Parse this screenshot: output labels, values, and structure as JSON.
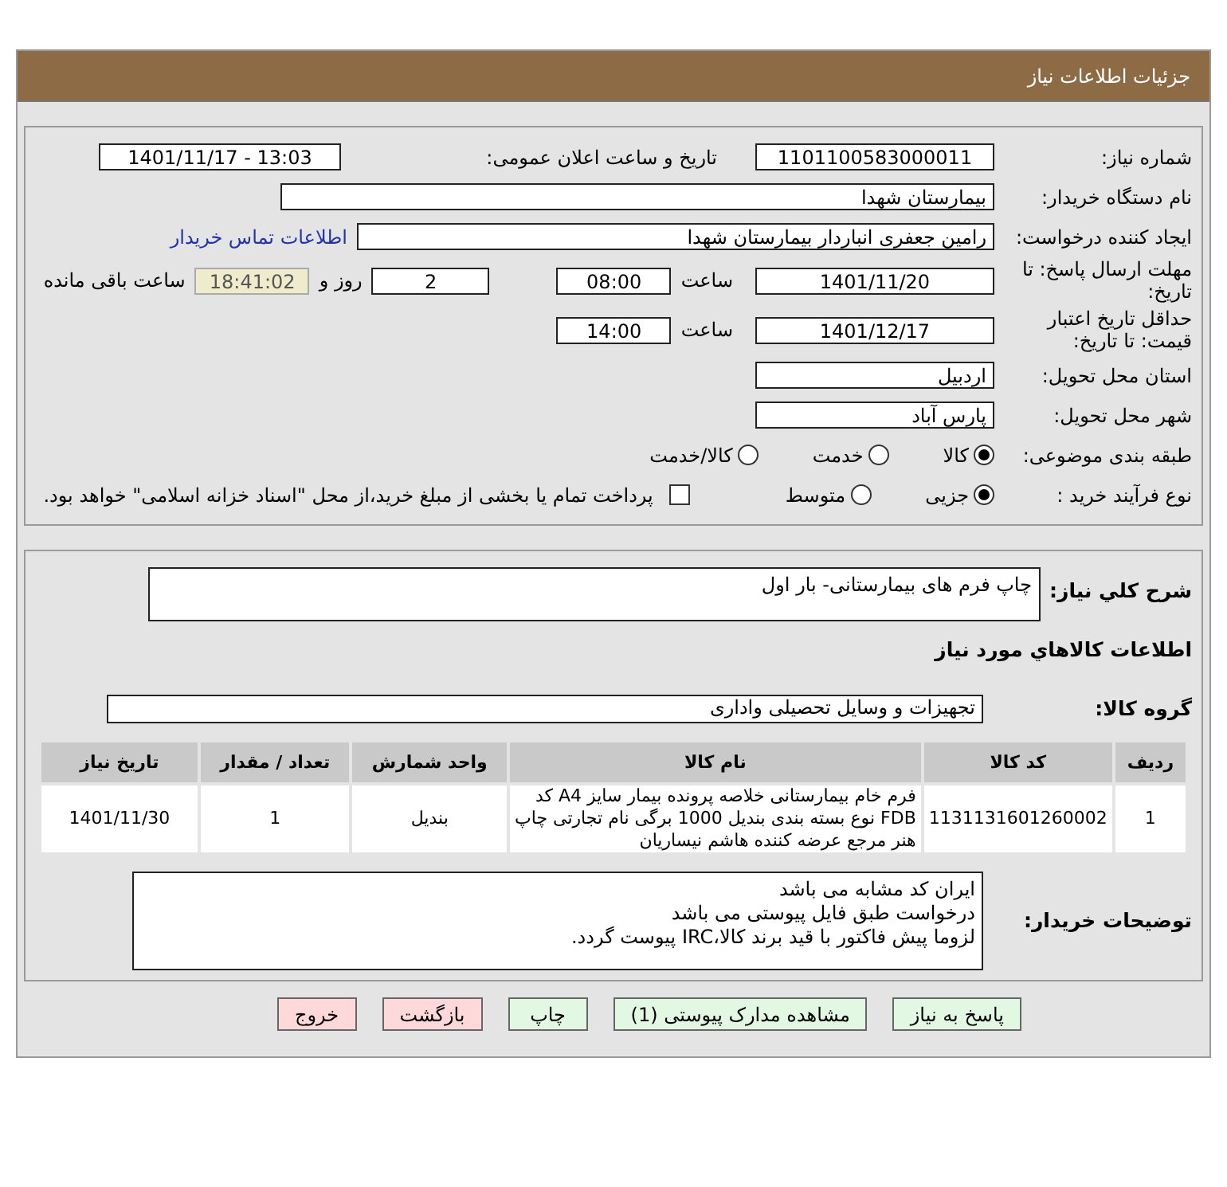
{
  "header": {
    "title": "جزئیات اطلاعات نیاز"
  },
  "need_number": {
    "label": "شماره نیاز:",
    "value": "1101100583000011"
  },
  "announce": {
    "label": "تاریخ و ساعت اعلان عمومی:",
    "value": "1401/11/17 - 13:03"
  },
  "buyer_org": {
    "label": "نام دستگاه خریدار:",
    "value": "بیمارستان شهدا"
  },
  "requester": {
    "label": "ایجاد کننده درخواست:",
    "value": "رامین جعفری انباردار بیمارستان شهدا",
    "link": "اطلاعات تماس خریدار"
  },
  "deadline": {
    "label": "مهلت ارسال پاسخ: تا تاریخ:",
    "date": "1401/11/20",
    "time_label": "ساعت",
    "time": "08:00",
    "days": "2",
    "days_label": "روز و",
    "remaining": "18:41:02",
    "remaining_label": "ساعت باقی مانده"
  },
  "validity": {
    "label": "حداقل تاریخ اعتبار قیمت: تا تاریخ:",
    "date": "1401/12/17",
    "time_label": "ساعت",
    "time": "14:00"
  },
  "province": {
    "label": "استان محل تحویل:",
    "value": "اردبیل"
  },
  "city": {
    "label": "شهر محل تحویل:",
    "value": "پارس آباد"
  },
  "category": {
    "label": "طبقه بندی موضوعی:",
    "options": [
      {
        "label": "کالا",
        "selected": true
      },
      {
        "label": "خدمت",
        "selected": false
      },
      {
        "label": "کالا/خدمت",
        "selected": false
      }
    ]
  },
  "process": {
    "label": "نوع فرآیند خرید :",
    "options": [
      {
        "label": "جزیی",
        "selected": true
      },
      {
        "label": "متوسط",
        "selected": false
      }
    ],
    "treasury": {
      "label": "پرداخت تمام یا بخشی از مبلغ خرید،از محل \"اسناد خزانه اسلامی\" خواهد بود.",
      "checked": false
    }
  },
  "description": {
    "label": "شرح کلي نياز:",
    "value": "چاپ فرم های بیمارستانی- بار اول"
  },
  "goods_title": "اطلاعات كالاهاي مورد نياز",
  "goods_group": {
    "label": "گروه کالا:",
    "value": "تجهیزات و وسایل تحصیلی واداری"
  },
  "table": {
    "columns": [
      "ردیف",
      "کد کالا",
      "نام کالا",
      "واحد شمارش",
      "تعداد / مقدار",
      "تاریخ نیاز"
    ],
    "rows": [
      [
        "1",
        "1131131601260002",
        "فرم خام بیمارستانی خلاصه پرونده بیمار سایز A4 کد FDB نوع بسته بندی بندیل 1000 برگی نام تجارتی چاپ هنر مرجع عرضه کننده هاشم نیساریان",
        "بندیل",
        "1",
        "1401/11/30"
      ]
    ]
  },
  "buyer_notes": {
    "label": "توضیحات خریدار:",
    "lines": [
      "ایران کد مشابه می باشد",
      "درخواست طبق فایل پیوستی می باشد",
      "لزوما پیش فاکتور با قید برند کالا،IRC  پیوست گردد."
    ]
  },
  "buttons": [
    {
      "label": "پاسخ به نیاز",
      "kind": "action"
    },
    {
      "label": "مشاهده مدارک پیوستی (1)",
      "kind": "action"
    },
    {
      "label": "چاپ",
      "kind": "action"
    },
    {
      "label": "بازگشت",
      "kind": "exit"
    },
    {
      "label": "خروج",
      "kind": "exit"
    }
  ]
}
